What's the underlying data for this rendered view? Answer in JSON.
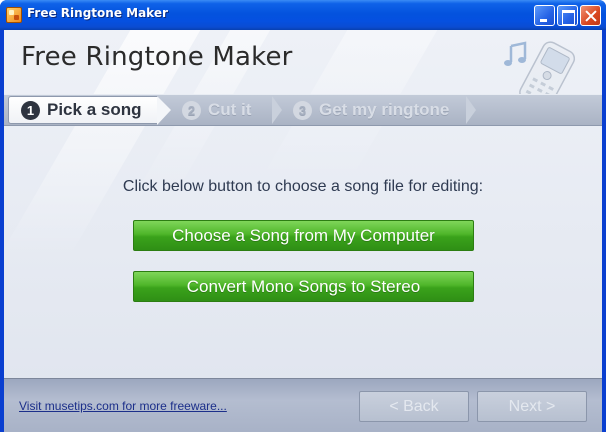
{
  "window": {
    "title": "Free Ringtone Maker",
    "controls": [
      "minimize",
      "maximize",
      "close"
    ]
  },
  "header": {
    "title": "Free Ringtone Maker",
    "icons": [
      "music-note-icon",
      "phone-icon"
    ]
  },
  "steps": [
    {
      "number": "1",
      "label": "Pick a song",
      "active": true
    },
    {
      "number": "2",
      "label": "Cut it",
      "active": false
    },
    {
      "number": "3",
      "label": "Get my ringtone",
      "active": false
    }
  ],
  "main": {
    "instruction": "Click below button to choose a song file for editing:",
    "choose_button": "Choose a Song from My Computer",
    "convert_button": "Convert Mono Songs to Stereo"
  },
  "footer": {
    "link": "Visit musetips.com for more freeware...",
    "back_button": "< Back",
    "next_button": "Next >"
  },
  "colors": {
    "titlebar": "#0453de",
    "green_button": "#3aa21b",
    "link": "#1c2f8a"
  }
}
